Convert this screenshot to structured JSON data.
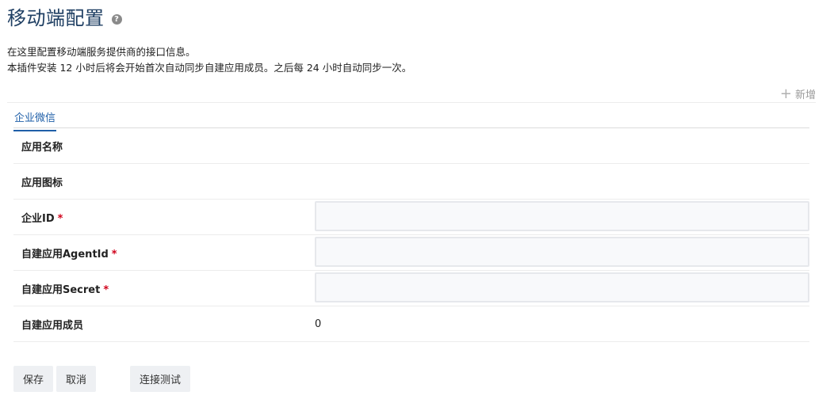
{
  "header": {
    "title": "移动端配置",
    "help_icon": "question-circle-icon"
  },
  "description": {
    "line1": "在这里配置移动端服务提供商的接口信息。",
    "line2": "本插件安装 12 小时后将会开始首次自动同步自建应用成员。之后每 24 小时自动同步一次。"
  },
  "toolbar": {
    "add_icon": "plus-icon",
    "add_label": "新增"
  },
  "tabs": [
    {
      "label": "企业微信",
      "active": true
    }
  ],
  "form": {
    "app_name": {
      "label": "应用名称"
    },
    "app_icon": {
      "label": "应用图标"
    },
    "corp_id": {
      "label": "企业ID",
      "required_mark": "*",
      "value": ""
    },
    "agent_id": {
      "label": "自建应用AgentId",
      "required_mark": "*",
      "value": ""
    },
    "secret": {
      "label": "自建应用Secret",
      "required_mark": "*",
      "value": ""
    },
    "members": {
      "label": "自建应用成员",
      "value": "0"
    }
  },
  "actions": {
    "save_label": "保存",
    "cancel_label": "取消",
    "test_label": "连接测试"
  },
  "colors": {
    "title": "#1f3f63",
    "accent": "#1f5fa8",
    "required": "#d0021b"
  }
}
